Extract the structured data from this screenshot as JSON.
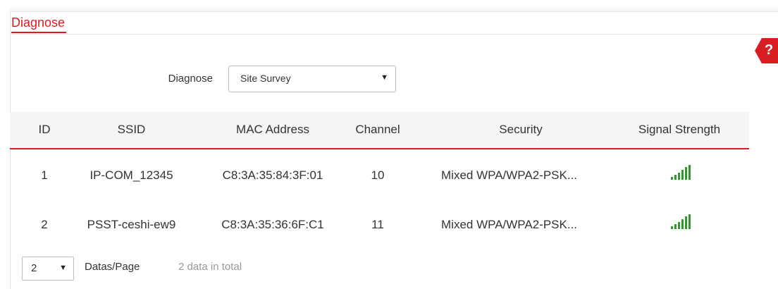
{
  "tab": {
    "title": "Diagnose"
  },
  "help": {
    "icon": "help-icon",
    "mark": "?"
  },
  "diagnose": {
    "label": "Diagnose",
    "selected": "Site Survey"
  },
  "table": {
    "headers": [
      "ID",
      "SSID",
      "MAC Address",
      "Channel",
      "Security",
      "Signal Strength"
    ],
    "rows": [
      {
        "id": "1",
        "ssid": "IP-COM_12345",
        "mac": "C8:3A:35:84:3F:01",
        "channel": "10",
        "security": "Mixed WPA/WPA2-PSK...",
        "signal_icon": "signal-strength-icon"
      },
      {
        "id": "2",
        "ssid": "PSST-ceshi-ew9",
        "mac": "C8:3A:35:36:6F:C1",
        "channel": "11",
        "security": "Mixed WPA/WPA2-PSK...",
        "signal_icon": "signal-strength-icon"
      }
    ]
  },
  "pagination": {
    "page_size": "2",
    "per_page_label": "Datas/Page",
    "total_label": "2 data in total"
  },
  "colors": {
    "accent": "#d81e23",
    "signal": "#2e9a2e",
    "header_bg": "#f5f5f5"
  }
}
